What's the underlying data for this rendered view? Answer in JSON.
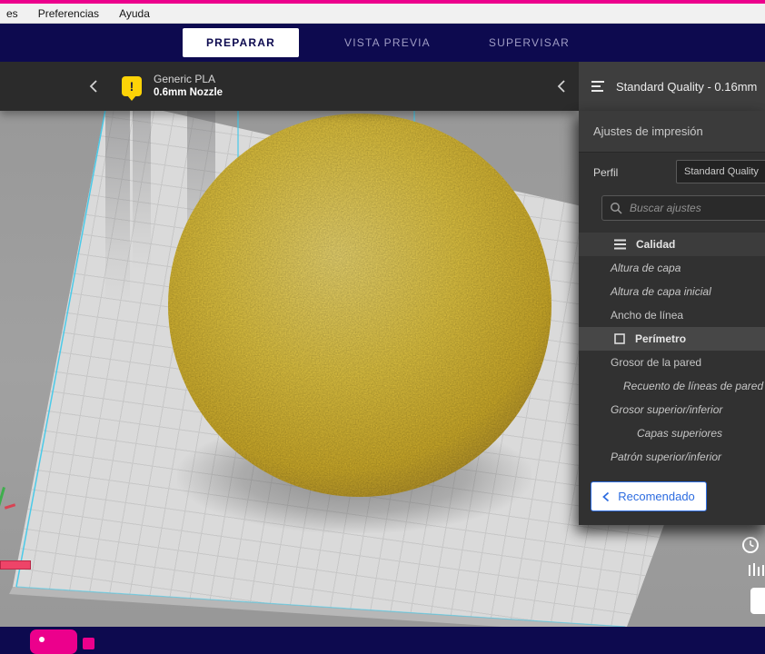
{
  "menubar": {
    "items": [
      "es",
      "Preferencias",
      "Ayuda"
    ]
  },
  "header": {
    "tabs": [
      {
        "label": "PREPARAR",
        "active": true
      },
      {
        "label": "VISTA PREVIA",
        "active": false
      },
      {
        "label": "SUPERVISAR",
        "active": false
      }
    ]
  },
  "stage": {
    "material": {
      "name": "Generic PLA",
      "nozzle": "0.6mm Nozzle",
      "warning_mark": "!"
    }
  },
  "panel": {
    "title": "Standard Quality - 0.16mm",
    "section": "Ajustes de impresión",
    "profile_label": "Perfil",
    "profile_value": "Standard Quality",
    "search_placeholder": "Buscar ajustes",
    "rows": [
      {
        "label": "Calidad",
        "type": "category"
      },
      {
        "label": "Altura de capa",
        "type": "setting",
        "modified": true
      },
      {
        "label": "Altura de capa inicial",
        "type": "setting",
        "modified": true
      },
      {
        "label": "Ancho de línea",
        "type": "setting",
        "modified": false
      },
      {
        "label": "Perímetro",
        "type": "category"
      },
      {
        "label": "Grosor de la pared",
        "type": "setting",
        "modified": false
      },
      {
        "label": "Recuento de líneas de pared",
        "type": "setting",
        "modified": true
      },
      {
        "label": "Grosor superior/inferior",
        "type": "setting",
        "modified": true
      },
      {
        "label": "Capas superiores",
        "type": "setting",
        "modified": true
      },
      {
        "label": "Patrón superior/inferior",
        "type": "setting",
        "modified": true
      }
    ],
    "recommended_button": "Recomendado"
  },
  "icons": {
    "collapse_left": "chevron-left",
    "collapse_right": "chevron-left",
    "panel_header": "print-settings",
    "search": "magnifier",
    "quality_category": "layers",
    "shell_category": "square-outline",
    "estimate": "clock",
    "queue": "bars"
  },
  "colors": {
    "accent_magenta": "#ec008c",
    "header_navy": "#0d0a4f",
    "cura_blue": "#2d6ce0",
    "model_gold": "#edcf45",
    "build_volume_cyan": "#3cc9ea",
    "warning_yellow": "#fdd307"
  }
}
